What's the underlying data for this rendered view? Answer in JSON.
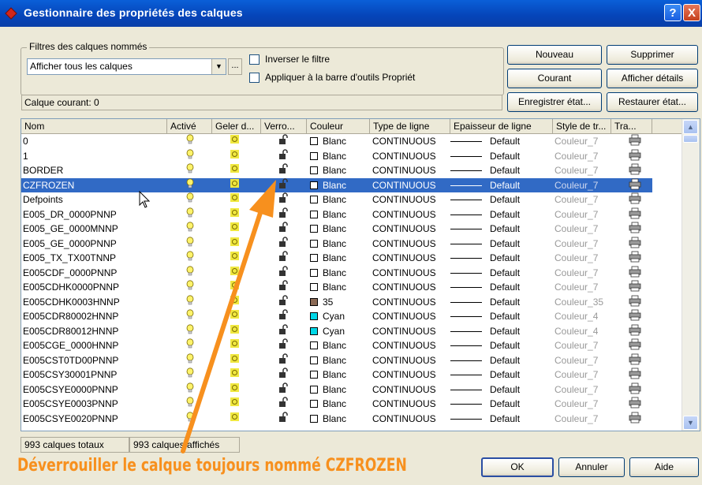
{
  "window": {
    "title": "Gestionnaire des propriétés des calques",
    "help_btn": "?",
    "close_btn": "X"
  },
  "filters": {
    "legend": "Filtres des calques nommés",
    "selected": "Afficher tous les calques",
    "dots": "...",
    "invert_label": "Inverser le filtre",
    "apply_label": "Appliquer à la barre d'outils Propriét"
  },
  "buttons": {
    "nouveau": "Nouveau",
    "supprimer": "Supprimer",
    "courant": "Courant",
    "afficher_details": "Afficher détails",
    "enregistrer": "Enregistrer état...",
    "restaurer": "Restaurer état...",
    "ok": "OK",
    "annuler": "Annuler",
    "aide": "Aide"
  },
  "current_layer": "Calque courant:  0",
  "columns": [
    "Nom",
    "Activé",
    "Geler d...",
    "Verro...",
    "Couleur",
    "Type de ligne",
    "Epaisseur de ligne",
    "Style de tr...",
    "Tra..."
  ],
  "rows": [
    {
      "name": "0",
      "color": "Blanc",
      "swatch": "#ffffff",
      "ltype": "CONTINUOUS",
      "lweight": "Default",
      "pstyle": "Couleur_7"
    },
    {
      "name": "1",
      "color": "Blanc",
      "swatch": "#ffffff",
      "ltype": "CONTINUOUS",
      "lweight": "Default",
      "pstyle": "Couleur_7"
    },
    {
      "name": "BORDER",
      "color": "Blanc",
      "swatch": "#ffffff",
      "ltype": "CONTINUOUS",
      "lweight": "Default",
      "pstyle": "Couleur_7"
    },
    {
      "name": "CZFROZEN",
      "color": "Blanc",
      "swatch": "#ffffff",
      "ltype": "CONTINUOUS",
      "lweight": "Default",
      "pstyle": "Couleur_7",
      "selected": true
    },
    {
      "name": "Defpoints",
      "color": "Blanc",
      "swatch": "#ffffff",
      "ltype": "CONTINUOUS",
      "lweight": "Default",
      "pstyle": "Couleur_7"
    },
    {
      "name": "E005_DR_0000PNNP",
      "color": "Blanc",
      "swatch": "#ffffff",
      "ltype": "CONTINUOUS",
      "lweight": "Default",
      "pstyle": "Couleur_7"
    },
    {
      "name": "E005_GE_0000MNNP",
      "color": "Blanc",
      "swatch": "#ffffff",
      "ltype": "CONTINUOUS",
      "lweight": "Default",
      "pstyle": "Couleur_7"
    },
    {
      "name": "E005_GE_0000PNNP",
      "color": "Blanc",
      "swatch": "#ffffff",
      "ltype": "CONTINUOUS",
      "lweight": "Default",
      "pstyle": "Couleur_7"
    },
    {
      "name": "E005_TX_TX00TNNP",
      "color": "Blanc",
      "swatch": "#ffffff",
      "ltype": "CONTINUOUS",
      "lweight": "Default",
      "pstyle": "Couleur_7"
    },
    {
      "name": "E005CDF_0000PNNP",
      "color": "Blanc",
      "swatch": "#ffffff",
      "ltype": "CONTINUOUS",
      "lweight": "Default",
      "pstyle": "Couleur_7"
    },
    {
      "name": "E005CDHK0000PNNP",
      "color": "Blanc",
      "swatch": "#ffffff",
      "ltype": "CONTINUOUS",
      "lweight": "Default",
      "pstyle": "Couleur_7"
    },
    {
      "name": "E005CDHK0003HNNP",
      "color": "35",
      "swatch": "#8b6a55",
      "ltype": "CONTINUOUS",
      "lweight": "Default",
      "pstyle": "Couleur_35"
    },
    {
      "name": "E005CDR80002HNNP",
      "color": "Cyan",
      "swatch": "#00d8e8",
      "ltype": "CONTINUOUS",
      "lweight": "Default",
      "pstyle": "Couleur_4"
    },
    {
      "name": "E005CDR80012HNNP",
      "color": "Cyan",
      "swatch": "#00d8e8",
      "ltype": "CONTINUOUS",
      "lweight": "Default",
      "pstyle": "Couleur_4"
    },
    {
      "name": "E005CGE_0000HNNP",
      "color": "Blanc",
      "swatch": "#ffffff",
      "ltype": "CONTINUOUS",
      "lweight": "Default",
      "pstyle": "Couleur_7"
    },
    {
      "name": "E005CST0TD00PNNP",
      "color": "Blanc",
      "swatch": "#ffffff",
      "ltype": "CONTINUOUS",
      "lweight": "Default",
      "pstyle": "Couleur_7"
    },
    {
      "name": "E005CSY30001PNNP",
      "color": "Blanc",
      "swatch": "#ffffff",
      "ltype": "CONTINUOUS",
      "lweight": "Default",
      "pstyle": "Couleur_7"
    },
    {
      "name": "E005CSYE0000PNNP",
      "color": "Blanc",
      "swatch": "#ffffff",
      "ltype": "CONTINUOUS",
      "lweight": "Default",
      "pstyle": "Couleur_7"
    },
    {
      "name": "E005CSYE0003PNNP",
      "color": "Blanc",
      "swatch": "#ffffff",
      "ltype": "CONTINUOUS",
      "lweight": "Default",
      "pstyle": "Couleur_7"
    },
    {
      "name": "E005CSYE0020PNNP",
      "color": "Blanc",
      "swatch": "#ffffff",
      "ltype": "CONTINUOUS",
      "lweight": "Default",
      "pstyle": "Couleur_7"
    }
  ],
  "status": {
    "total": "993 calques totaux",
    "shown": "993 calques affichés"
  },
  "annotation": "Déverrouiller le calque toujours nommé CZFROZEN",
  "colors": {
    "selection": "#316ac5",
    "annotation": "#f7901e",
    "titlebar": "#0a5fd8"
  }
}
